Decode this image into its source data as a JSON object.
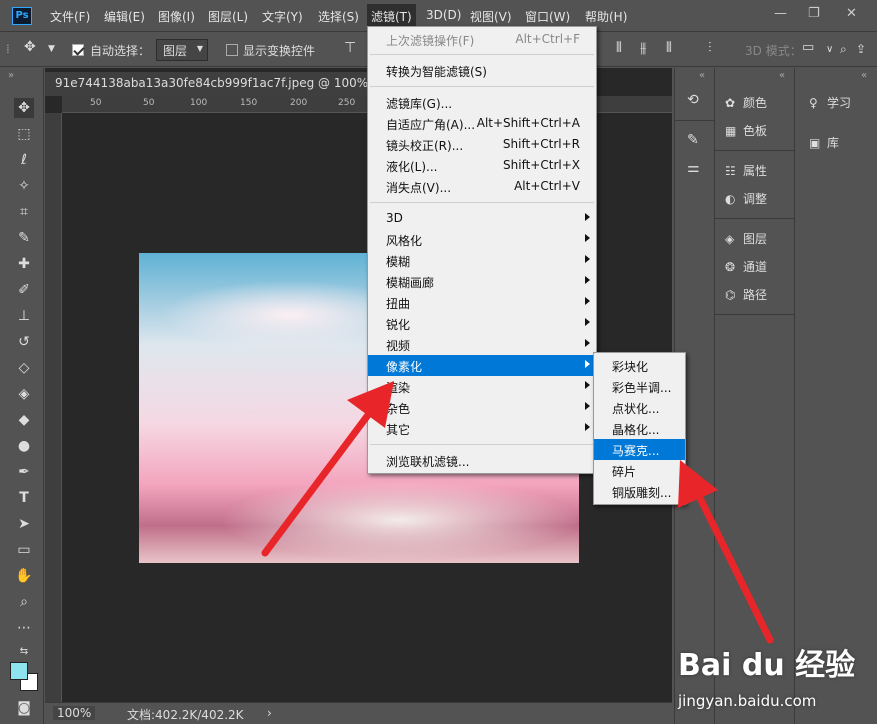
{
  "menubar": {
    "logo": "Ps",
    "items": [
      "文件(F)",
      "编辑(E)",
      "图像(I)",
      "图层(L)",
      "文字(Y)",
      "选择(S)",
      "滤镜(T)",
      "3D(D)",
      "视图(V)",
      "窗口(W)",
      "帮助(H)"
    ]
  },
  "options": {
    "auto_select_label": "自动选择：",
    "layer_dropdown": "图层",
    "show_transform_label": "显示变换控件",
    "mode_3d": "3D 模式："
  },
  "document": {
    "tab_title": "91e744138aba13a30fe84cb999f1ac7f.jpeg @ 100%(RGB",
    "ruler_ticks": [
      "50",
      "50",
      "100",
      "150",
      "200",
      "250",
      "300",
      "350",
      "400",
      "450",
      "500",
      "550"
    ],
    "zoom": "100%",
    "doc_size": "文档:402.2K/402.2K"
  },
  "filter_menu": {
    "items": [
      {
        "label": "上次滤镜操作(F)",
        "shortcut": "Alt+Ctrl+F",
        "disabled": true
      },
      {
        "label": "转换为智能滤镜(S)"
      },
      {
        "label": "滤镜库(G)..."
      },
      {
        "label": "自适应广角(A)...",
        "shortcut": "Alt+Shift+Ctrl+A"
      },
      {
        "label": "镜头校正(R)...",
        "shortcut": "Shift+Ctrl+R"
      },
      {
        "label": "液化(L)...",
        "shortcut": "Shift+Ctrl+X"
      },
      {
        "label": "消失点(V)...",
        "shortcut": "Alt+Ctrl+V"
      },
      {
        "label": "3D",
        "submenu": true
      },
      {
        "label": "风格化",
        "submenu": true
      },
      {
        "label": "模糊",
        "submenu": true
      },
      {
        "label": "模糊画廊",
        "submenu": true
      },
      {
        "label": "扭曲",
        "submenu": true
      },
      {
        "label": "锐化",
        "submenu": true
      },
      {
        "label": "视频",
        "submenu": true
      },
      {
        "label": "像素化",
        "submenu": true,
        "highlighted": true
      },
      {
        "label": "渲染",
        "submenu": true
      },
      {
        "label": "杂色",
        "submenu": true
      },
      {
        "label": "其它",
        "submenu": true
      },
      {
        "label": "浏览联机滤镜..."
      }
    ]
  },
  "pixelate_submenu": {
    "items": [
      "彩块化",
      "彩色半调...",
      "点状化...",
      "晶格化...",
      "马赛克...",
      "碎片",
      "铜版雕刻..."
    ],
    "highlighted_index": 4
  },
  "panels": {
    "dock2": [
      "颜色",
      "色板",
      "属性",
      "调整",
      "图层",
      "通道",
      "路径"
    ],
    "dock3": [
      "学习",
      "库"
    ]
  },
  "watermark": {
    "brand": "Bai du 经验",
    "url": "jingyan.baidu.com"
  },
  "colors": {
    "highlight": "#0078d7",
    "arrow": "#e8262a"
  }
}
